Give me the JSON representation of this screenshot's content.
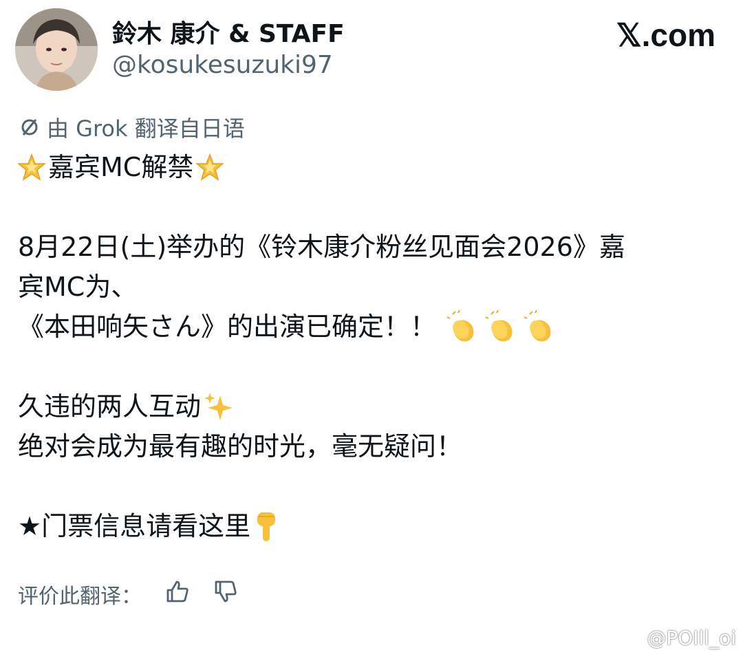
{
  "header": {
    "display_name": "鈴木 康介 & STAFF",
    "handle": "@kosukesuzuki97",
    "site_label": "𝕏.com"
  },
  "translation": {
    "label": "由 Grok 翻译自日语"
  },
  "tweet": {
    "line1": "嘉宾MC解禁",
    "line2": "8月22日(土)举办的《铃木康介粉丝见面会2026》嘉",
    "line3": "宾MC为、",
    "line4": "《本田响矢さん》的出演已确定！！",
    "line5": "久违的两人互动",
    "line6": "绝对会成为最有趣的时光，毫无疑问！",
    "line7": "★门票信息请看这里"
  },
  "rate_translation": {
    "label": "评价此翻译："
  },
  "watermark": {
    "text": "@POIll_oi"
  },
  "icons": {
    "avatar": "avatar-photo",
    "translate": "translate-slash-icon",
    "star": "glowing-star-emoji",
    "clap": "clapping-hands-emoji",
    "sparkles": "sparkles-emoji",
    "point": "pointing-down-emoji",
    "thumbs_up": "thumbs-up-icon",
    "thumbs_down": "thumbs-down-icon",
    "weibo": "weibo-icon"
  },
  "colors": {
    "text": "#0f1419",
    "secondary": "#536471",
    "emoji_yellow": "#f7c03a"
  }
}
